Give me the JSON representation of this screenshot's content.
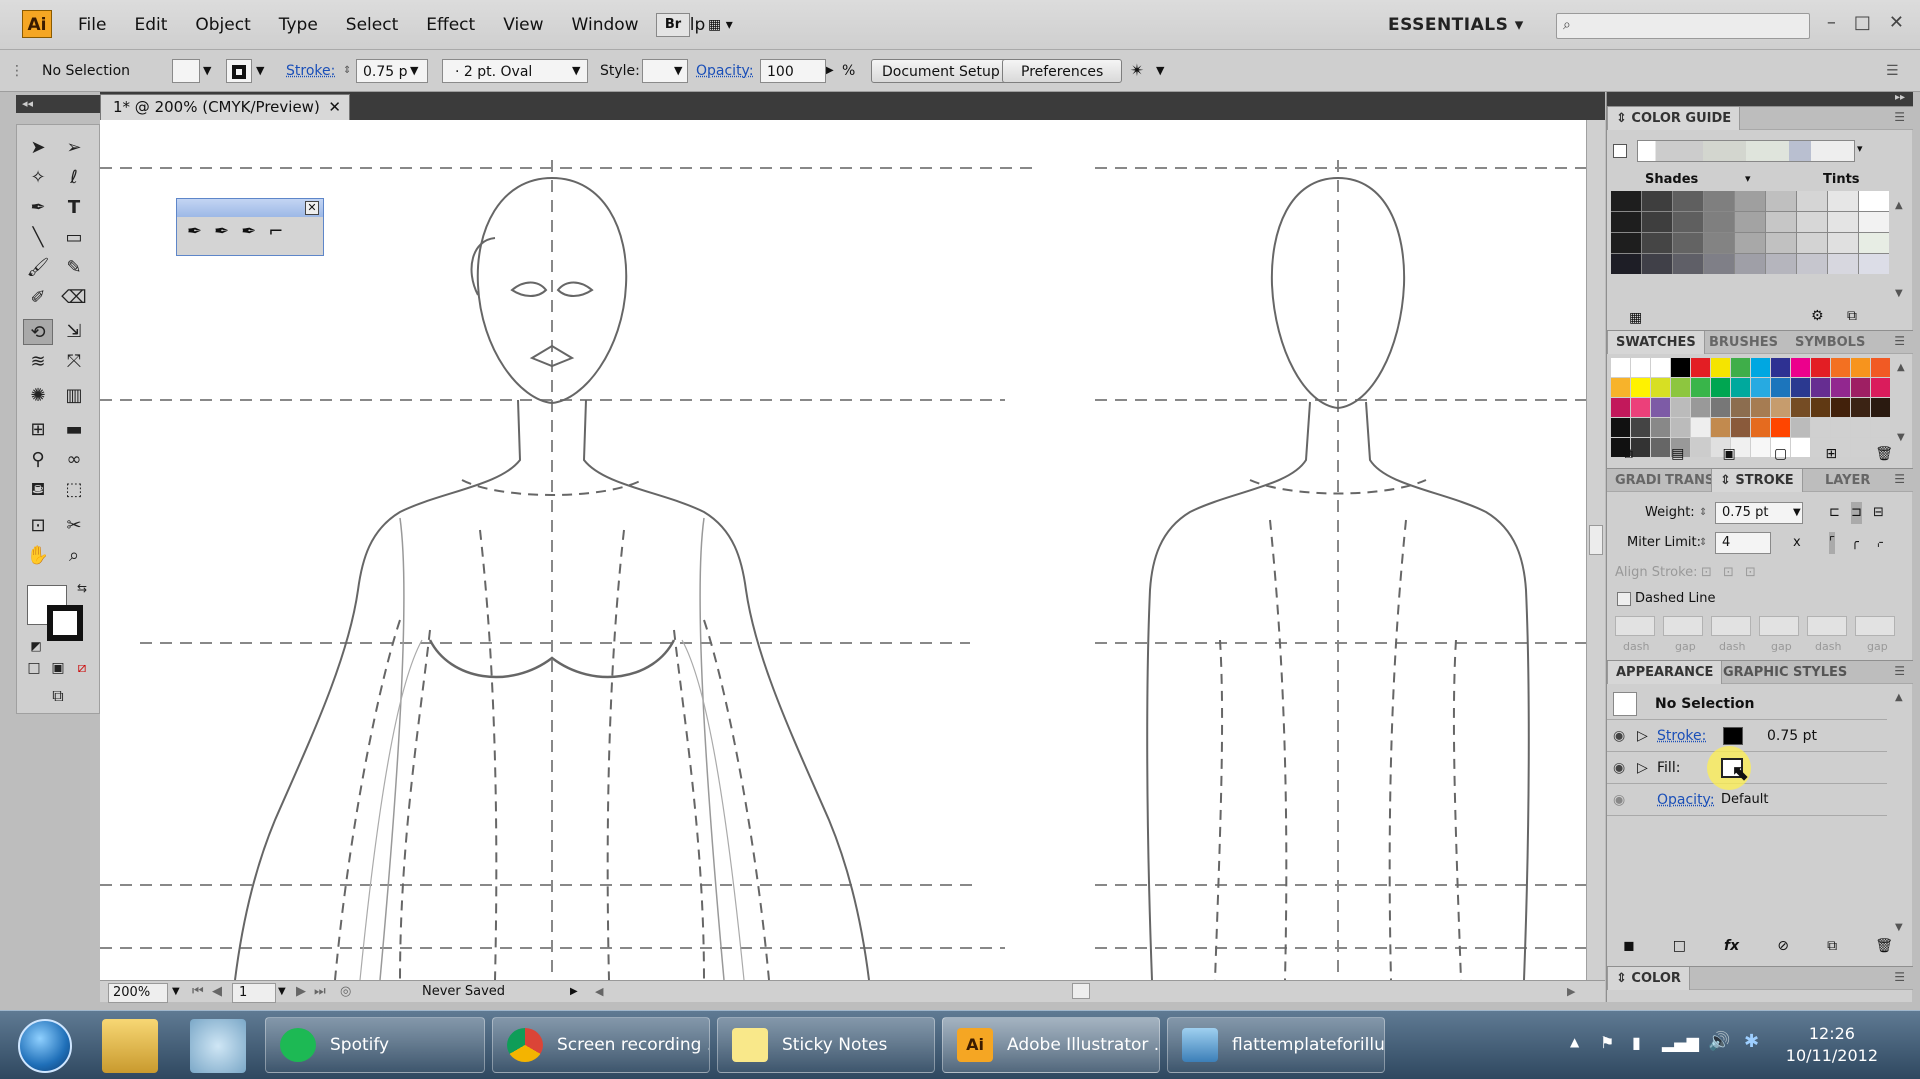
{
  "app": {
    "logo": "Ai",
    "menus": [
      "File",
      "Edit",
      "Object",
      "Type",
      "Select",
      "Effect",
      "View",
      "Window",
      "Help"
    ],
    "bridge_label": "Br",
    "workspace": "ESSENTIALS"
  },
  "control_bar": {
    "selection": "No Selection",
    "stroke_label": "Stroke:",
    "stroke_weight": "0.75 p",
    "brush": "2 pt. Oval",
    "style_label": "Style:",
    "opacity_label": "Opacity:",
    "opacity_value": "100",
    "opacity_unit": "%",
    "document_setup": "Document Setup",
    "preferences": "Preferences"
  },
  "document": {
    "tab_title": "1* @ 200% (CMYK/Preview)",
    "zoom": "200%",
    "artboard": "1",
    "status": "Never Saved"
  },
  "color_guide": {
    "title": "COLOR GUIDE",
    "shades_label": "Shades",
    "tints_label": "Tints"
  },
  "swatch_tabs": [
    "SWATCHES",
    "BRUSHES",
    "SYMBOLS"
  ],
  "stroke_tabs": [
    "GRADI",
    "TRANS",
    "STROKE",
    "LAYER"
  ],
  "stroke_panel": {
    "weight_label": "Weight:",
    "weight_value": "0.75 pt",
    "miter_label": "Miter Limit:",
    "miter_value": "4",
    "miter_unit": "x",
    "align_label": "Align Stroke:",
    "dashed_label": "Dashed Line",
    "dash_labels": [
      "dash",
      "gap",
      "dash",
      "gap",
      "dash",
      "gap"
    ]
  },
  "appearance": {
    "tabs": [
      "APPEARANCE",
      "GRAPHIC STYLES"
    ],
    "selection": "No Selection",
    "stroke_label": "Stroke:",
    "stroke_value": "0.75 pt",
    "fill_label": "Fill:",
    "opacity_label": "Opacity:",
    "opacity_value": "Default"
  },
  "color_panel_title": "COLOR",
  "taskbar": {
    "items": [
      "Spotify",
      "Screen recording ...",
      "Sticky Notes",
      "Adobe Illustrator ...",
      "flattemplateforillu..."
    ],
    "time": "12:26",
    "date": "10/11/2012"
  },
  "colors": {
    "accent_link": "#1a4fb8",
    "illustrator_orange": "#f5a623",
    "taskbar": "#3f5a74",
    "canvas": "#ffffff"
  }
}
